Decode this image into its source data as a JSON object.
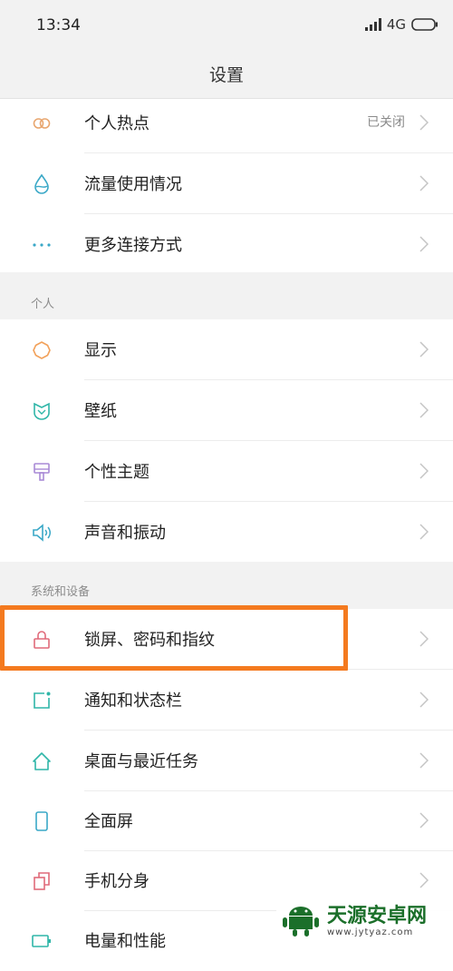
{
  "status_bar": {
    "time": "13:34",
    "network": "4G"
  },
  "header": {
    "title": "设置"
  },
  "group_network": [
    {
      "label": "个人热点",
      "value": "已关闭",
      "icon": "hotspot-icon",
      "color": "#e8a66f"
    },
    {
      "label": "流量使用情况",
      "value": "",
      "icon": "data-usage-icon",
      "color": "#3aa8c7"
    },
    {
      "label": "更多连接方式",
      "value": "",
      "icon": "more-dots-icon",
      "color": "#3aa8c7"
    }
  ],
  "section_personal": {
    "title": "个人"
  },
  "group_personal": [
    {
      "label": "显示",
      "icon": "display-sun-icon",
      "color": "#f2a15a"
    },
    {
      "label": "壁纸",
      "icon": "wallpaper-icon",
      "color": "#2fb6a8"
    },
    {
      "label": "个性主题",
      "icon": "theme-brush-icon",
      "color": "#a98ad6"
    },
    {
      "label": "声音和振动",
      "icon": "sound-speaker-icon",
      "color": "#3aa8c7"
    }
  ],
  "section_system": {
    "title": "系统和设备"
  },
  "group_system": [
    {
      "label": "锁屏、密码和指纹",
      "icon": "lock-icon",
      "color": "#e06a7a",
      "highlighted": true
    },
    {
      "label": "通知和状态栏",
      "icon": "notification-icon",
      "color": "#2fb6a8"
    },
    {
      "label": "桌面与最近任务",
      "icon": "home-icon",
      "color": "#2fb6a8"
    },
    {
      "label": "全面屏",
      "icon": "fullscreen-phone-icon",
      "color": "#3aa8c7"
    },
    {
      "label": "手机分身",
      "icon": "dual-copy-icon",
      "color": "#e06a7a"
    },
    {
      "label": "电量和性能",
      "icon": "battery-icon",
      "color": "#2fb6a8"
    }
  ],
  "watermark": {
    "name": "天源安卓网",
    "url": "www.jytyaz.com"
  },
  "colors": {
    "highlight": "#f47a1f",
    "section_bg": "#f2f2f2",
    "chevron": "#c4c4c4"
  }
}
